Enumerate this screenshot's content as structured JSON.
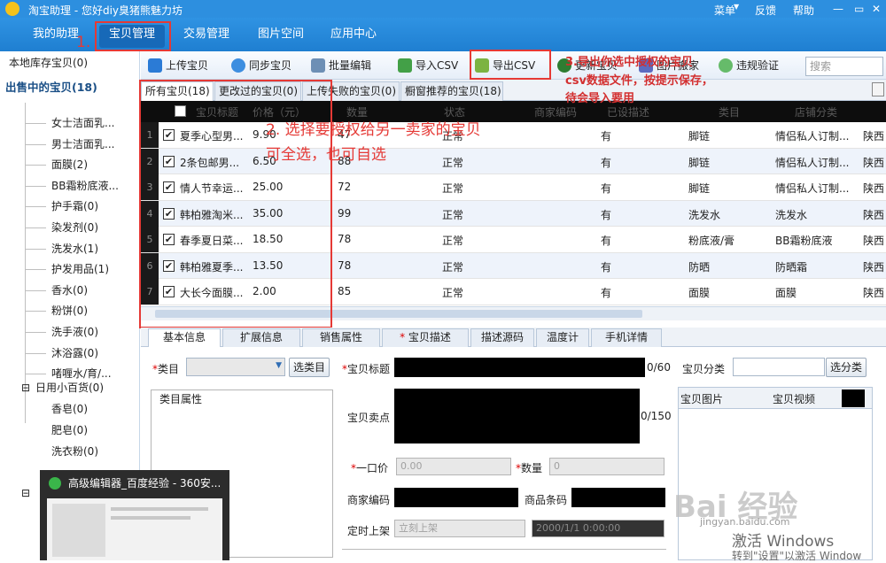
{
  "titlebar": {
    "title": "淘宝助理 - 您好diy臭猪熊魅力坊",
    "menu": [
      "菜单",
      "反馈",
      "帮助"
    ]
  },
  "nav": {
    "tabs": [
      "我的助理",
      "宝贝管理",
      "交易管理",
      "图片空间",
      "应用中心"
    ],
    "step1": "1."
  },
  "tree": {
    "local": "本地库存宝贝(0)",
    "onsale": "出售中的宝贝(18)",
    "items": [
      "女士洁面乳...",
      "男士洁面乳...",
      "面膜(2)",
      "BB霜粉底液...",
      "护手霜(0)",
      "染发剂(0)",
      "洗发水(1)",
      "护发用品(1)",
      "香水(0)",
      "粉饼(0)",
      "洗手液(0)",
      "沐浴露(0)",
      "啫喱水/育/..."
    ],
    "group2": "日用小百货(0)",
    "group2_items": [
      "香皂(0)",
      "肥皂(0)",
      "洗衣粉(0)"
    ]
  },
  "toolbar": {
    "upload": "上传宝贝",
    "sync": "同步宝贝",
    "batch": "批量编辑",
    "import": "导入CSV",
    "export": "导出CSV",
    "update": "更新宝贝",
    "print": "图片搬家",
    "violation": "违规验证",
    "search_placeholder": "搜索"
  },
  "subtabs": [
    "所有宝贝(18)",
    "更改过的宝贝(0)",
    "上传失败的宝贝(0)",
    "橱窗推荐的宝贝(18)"
  ],
  "grid": {
    "headers": [
      "宝贝标题",
      "价格（元）",
      "数量",
      "状态",
      "商家编码",
      "已设描述",
      "类目",
      "店铺分类"
    ],
    "rows": [
      {
        "n": "1",
        "title": "夏季心型男...",
        "price": "9.90",
        "qty": "47",
        "status": "正常",
        "desc": "有",
        "cat": "脚链",
        "shop": "情侣私人订制...",
        "loc": "陕西"
      },
      {
        "n": "2",
        "title": "2条包邮男...",
        "price": "6.50",
        "qty": "88",
        "status": "正常",
        "desc": "有",
        "cat": "脚链",
        "shop": "情侣私人订制...",
        "loc": "陕西"
      },
      {
        "n": "3",
        "title": "情人节幸运...",
        "price": "25.00",
        "qty": "72",
        "status": "正常",
        "desc": "有",
        "cat": "脚链",
        "shop": "情侣私人订制...",
        "loc": "陕西"
      },
      {
        "n": "4",
        "title": "韩柏雅淘米...",
        "price": "35.00",
        "qty": "99",
        "status": "正常",
        "desc": "有",
        "cat": "洗发水",
        "shop": "洗发水",
        "loc": "陕西"
      },
      {
        "n": "5",
        "title": "春季夏日菜...",
        "price": "18.50",
        "qty": "78",
        "status": "正常",
        "desc": "有",
        "cat": "粉底液/膏",
        "shop": "BB霜粉底液",
        "loc": "陕西"
      },
      {
        "n": "6",
        "title": "韩柏雅夏季...",
        "price": "13.50",
        "qty": "78",
        "status": "正常",
        "desc": "有",
        "cat": "防晒",
        "shop": "防晒霜",
        "loc": "陕西"
      },
      {
        "n": "7",
        "title": "大长今面膜...",
        "price": "2.00",
        "qty": "85",
        "status": "正常",
        "desc": "有",
        "cat": "面膜",
        "shop": "面膜",
        "loc": "陕西"
      }
    ]
  },
  "bottomtabs": [
    "基本信息",
    "扩展信息",
    "销售属性",
    "宝贝描述",
    "描述源码",
    "温度计",
    "手机详情"
  ],
  "form": {
    "category": "类目",
    "choose_category": "选类目",
    "title": "宝贝标题",
    "title_count": "0/60",
    "shop_cat": "宝贝分类",
    "choose_shop_cat": "选分类",
    "attrs": "类目属性",
    "selling": "宝贝卖点",
    "selling_count": "0/150",
    "price": "一口价",
    "price_val": "0.00",
    "qty": "数量",
    "qty_val": "0",
    "merchant_code": "商家编码",
    "barcode": "商品条码",
    "schedule": "定时上架",
    "schedule_val": "立刻上架",
    "datetime_val": "2000/1/1 0:00:00",
    "img_tab": "宝贝图片",
    "video_tab": "宝贝视频"
  },
  "annotations": {
    "step2": "2. 选择要授权给另一卖家的宝贝",
    "step2b": "可全选，也可自选",
    "step3a": "3.导出你选中授权的宝贝",
    "step3b": "csv数据文件，按提示保存，",
    "step3c": "待会导入要用"
  },
  "popup": {
    "title": "高级编辑器_百度经验 - 360安..."
  },
  "watermark": {
    "brand": "Bai 经验",
    "site": "jingyan.baidu.com",
    "win1": "激活 Windows",
    "win2": "转到\"设置\"以激活 Window"
  }
}
